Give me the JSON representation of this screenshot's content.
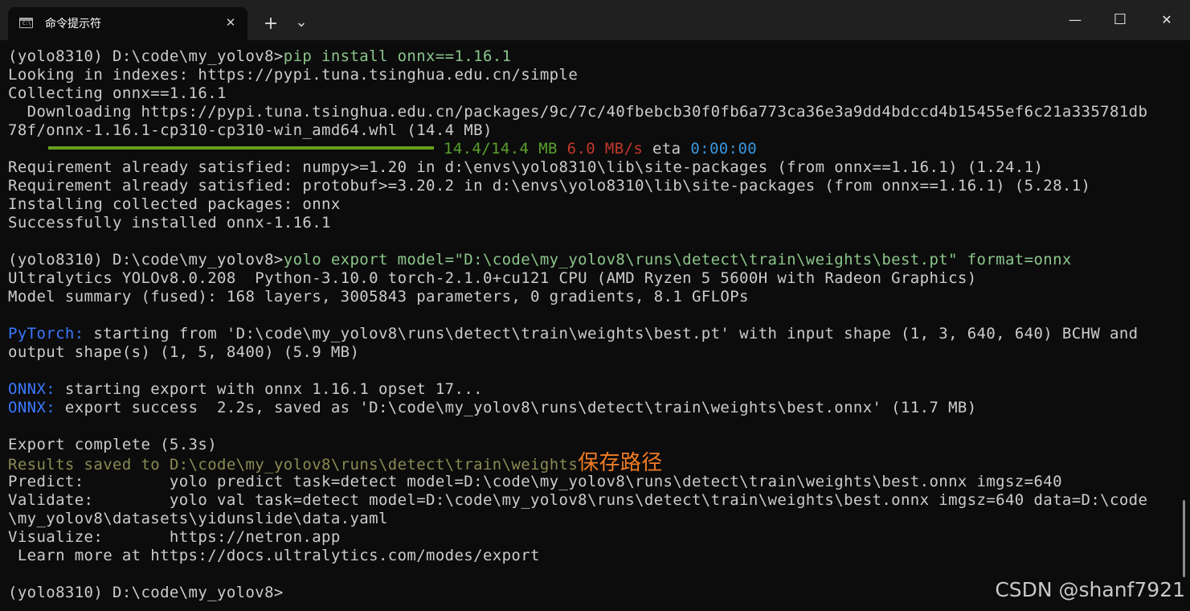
{
  "window": {
    "tab_title": "命令提示符",
    "tab_icon": "cmd-icon",
    "tab_icon_glyph": "C:\\",
    "tab_close": "✕",
    "new_tab": "+",
    "dropdown": "⌄",
    "minimize": "—",
    "maximize": "☐",
    "close": "✕"
  },
  "terminal": {
    "l01_prompt": "(yolo8310) D:\\code\\my_yolov8>",
    "l01_cmd": "pip install onnx==1.16.1",
    "l02": "Looking in indexes: https://pypi.tuna.tsinghua.edu.cn/simple",
    "l03": "Collecting onnx==1.16.1",
    "l04": "  Downloading https://pypi.tuna.tsinghua.edu.cn/packages/9c/7c/40fbebcb30f0fb6a773ca36e3a9dd4bdccd4b15455ef6c21a335781db",
    "l05": "78f/onnx-1.16.1-cp310-cp310-win_amd64.whl (14.4 MB)",
    "l06_size": "14.4/14.4 MB",
    "l06_speed": "6.0 MB/s",
    "l06_eta_label": "eta",
    "l06_eta": "0:00:00",
    "l07": "Requirement already satisfied: numpy>=1.20 in d:\\envs\\yolo8310\\lib\\site-packages (from onnx==1.16.1) (1.24.1)",
    "l08": "Requirement already satisfied: protobuf>=3.20.2 in d:\\envs\\yolo8310\\lib\\site-packages (from onnx==1.16.1) (5.28.1)",
    "l09": "Installing collected packages: onnx",
    "l10": "Successfully installed onnx-1.16.1",
    "l12_prompt": "(yolo8310) D:\\code\\my_yolov8>",
    "l12_cmd": "yolo export model=\"D:\\code\\my_yolov8\\runs\\detect\\train\\weights\\best.pt\" format=onnx",
    "l13": "Ultralytics YOLOv8.0.208  Python-3.10.0 torch-2.1.0+cu121 CPU (AMD Ryzen 5 5600H with Radeon Graphics)",
    "l14": "Model summary (fused): 168 layers, 3005843 parameters, 0 gradients, 8.1 GFLOPs",
    "l16_label": "PyTorch:",
    "l16_text": " starting from 'D:\\code\\my_yolov8\\runs\\detect\\train\\weights\\best.pt' with input shape (1, 3, 640, 640) BCHW and",
    "l17": "output shape(s) (1, 5, 8400) (5.9 MB)",
    "l19_label": "ONNX:",
    "l19_text": " starting export with onnx 1.16.1 opset 17...",
    "l20_label": "ONNX:",
    "l20_text": " export success  2.2s, saved as 'D:\\code\\my_yolov8\\runs\\detect\\train\\weights\\best.onnx' (11.7 MB)",
    "l22": "Export complete (5.3s)",
    "l23_label": "Results saved to ",
    "l23_path": "D:\\code\\my_yolov8\\runs\\detect\\train\\weights",
    "l23_annotation": "保存路径",
    "l24": "Predict:         yolo predict task=detect model=D:\\code\\my_yolov8\\runs\\detect\\train\\weights\\best.onnx imgsz=640",
    "l25": "Validate:        yolo val task=detect model=D:\\code\\my_yolov8\\runs\\detect\\train\\weights\\best.onnx imgsz=640 data=D:\\code",
    "l26": "\\my_yolov8\\datasets\\yidunslide\\data.yaml",
    "l27": "Visualize:       https://netron.app",
    "l28": " Learn more at https://docs.ultralytics.com/modes/export",
    "l30_prompt": "(yolo8310) D:\\code\\my_yolov8>"
  },
  "progress": {
    "fraction": 1.0
  },
  "watermark": "CSDN @shanf7921",
  "colors": {
    "background": "#0c0c0c",
    "text": "#cccccc",
    "command": "#8bc58b",
    "progress": "#6a9e1f",
    "speed": "#c0392b",
    "eta": "#3a96dd",
    "label": "#3b78ff",
    "annotation": "#f07b24"
  }
}
